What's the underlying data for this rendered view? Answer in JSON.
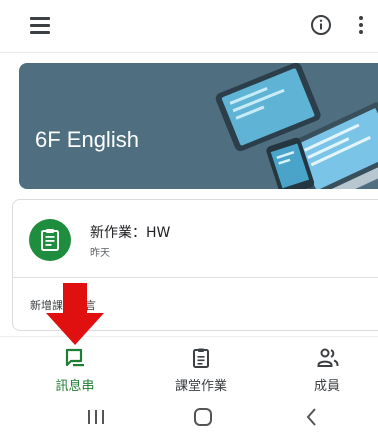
{
  "appbar": {
    "menu_icon": "hamburger-menu-icon",
    "info_icon": "info-circle-icon",
    "more_icon": "more-vert-icon"
  },
  "banner": {
    "class_name": "6F English",
    "background_color": "#4f6f80"
  },
  "post": {
    "title": "新作業：HW",
    "date": "昨天",
    "icon": "assignment-icon",
    "avatar_color": "#1e8e3e"
  },
  "comment": {
    "placeholder": "新增課堂留言"
  },
  "bottom_nav": {
    "items": [
      {
        "label": "訊息串",
        "icon": "stream-icon",
        "active": true
      },
      {
        "label": "課堂作業",
        "icon": "classwork-icon",
        "active": false
      },
      {
        "label": "成員",
        "icon": "people-icon",
        "active": false
      }
    ],
    "active_color": "#1e7e34"
  },
  "system_nav": {
    "recents_icon": "recents-icon",
    "home_icon": "home-icon",
    "back_icon": "back-icon"
  },
  "annotation": {
    "arrow_color": "#e01010"
  }
}
